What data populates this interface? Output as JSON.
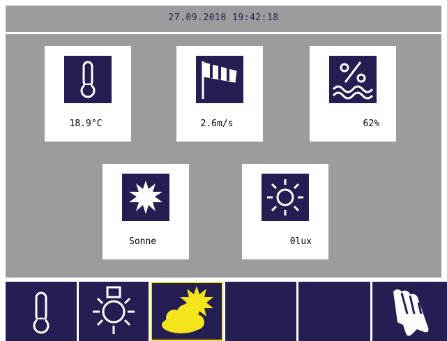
{
  "header": {
    "datetime": "27.09.2010 19:42:18"
  },
  "tiles": [
    {
      "icon": "thermometer-icon",
      "value": "18.9°C"
    },
    {
      "icon": "windsock-icon",
      "value": "2.6m/s"
    },
    {
      "icon": "humidity-icon",
      "value": "62%"
    },
    {
      "icon": "sun-burst-icon",
      "value": "Sonne"
    },
    {
      "icon": "sun-outline-icon",
      "value": "0lux"
    }
  ],
  "tabs": [
    {
      "icon": "thermometer-icon",
      "active": false
    },
    {
      "icon": "light-bulb-icon",
      "active": false
    },
    {
      "icon": "sun-cloud-icon",
      "active": true
    },
    {
      "icon": "",
      "active": false
    },
    {
      "icon": "",
      "active": false
    },
    {
      "icon": "cleaning-cloth-icon",
      "active": false
    }
  ],
  "colors": {
    "background_panel": "#9c9c9c",
    "tile": "#ffffff",
    "icon_background": "#241e52",
    "active_tab_border": "#f3e41b",
    "weather_icon_yellow": "#f3e41b"
  }
}
